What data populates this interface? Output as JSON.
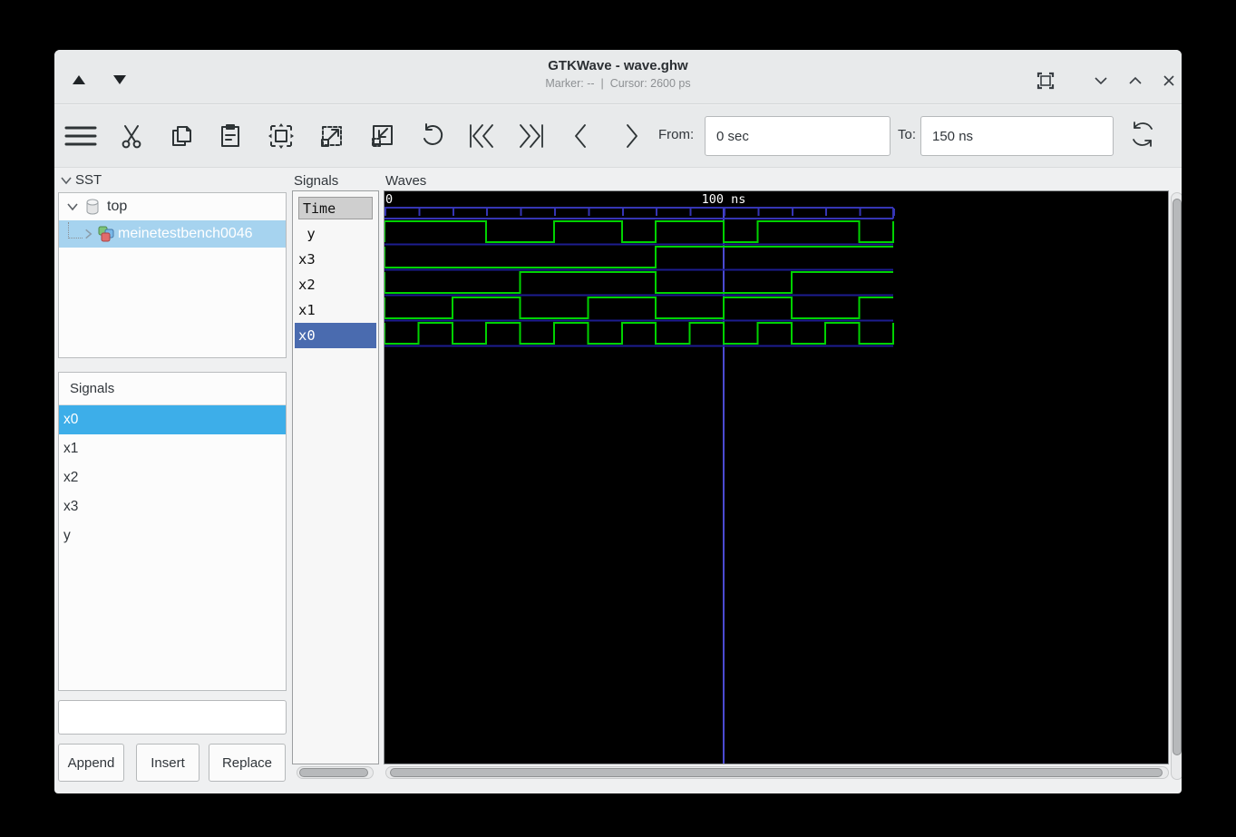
{
  "colors": {
    "selection": "#3daee9",
    "selection_inactive": "#a6d3ef",
    "signal_row_selected": "#4a6baf",
    "window_bg": "#eff0f1",
    "titlebar_bg": "#e8eaeb"
  },
  "titlebar": {
    "title": "GTKWave - wave.ghw",
    "marker_text": "Marker: --",
    "separator": "|",
    "cursor_text": "Cursor: 2600 ps"
  },
  "toolbar": {
    "from_label": "From:",
    "from_value": "0 sec",
    "to_label": "To:",
    "to_value": "150 ns"
  },
  "sst": {
    "header": "SST",
    "nodes": [
      {
        "label": "top",
        "expanded": true
      },
      {
        "label": "meinetestbench0046",
        "expanded": false,
        "selected": true
      }
    ]
  },
  "search_panel": {
    "header": "Signals",
    "items": [
      "x0",
      "x1",
      "x2",
      "x3",
      "y"
    ],
    "selected_item": "x0",
    "search_value": "",
    "buttons": [
      "Append",
      "Insert",
      "Replace"
    ]
  },
  "signals_panel": {
    "frame_label": "Signals",
    "time_header": "Time",
    "rows": [
      " y",
      "x3",
      "x2",
      "x1",
      "x0"
    ],
    "selected_row": "x0"
  },
  "waves_panel": {
    "frame_label": "Waves"
  },
  "chart_data": {
    "type": "digital-waveform",
    "time_unit": "ns",
    "t_start": 0,
    "t_end": 150,
    "tick_interval": 10,
    "timeline_labels": [
      {
        "t": 0,
        "text": "0"
      },
      {
        "t": 100,
        "text": "100 ns"
      }
    ],
    "grid_vertical_lines_t": [
      100
    ],
    "signals": [
      {
        "name": "y",
        "initial": 1,
        "toggle_times": [
          30,
          50,
          70,
          80,
          100,
          110,
          140,
          150
        ]
      },
      {
        "name": "x3",
        "initial": 0,
        "toggle_times": [
          80
        ]
      },
      {
        "name": "x2",
        "initial": 0,
        "toggle_times": [
          40,
          80,
          120
        ]
      },
      {
        "name": "x1",
        "initial": 0,
        "toggle_times": [
          20,
          40,
          60,
          80,
          100,
          120,
          140
        ]
      },
      {
        "name": "x0",
        "initial": 0,
        "toggle_times": [
          10,
          20,
          30,
          40,
          50,
          60,
          70,
          80,
          90,
          100,
          110,
          120,
          130,
          140,
          150
        ]
      }
    ],
    "colors": {
      "trace": "#00d200",
      "separator": "#1d1d8f",
      "ruler": "#3535b4",
      "grid_line": "#4a4ad2",
      "background": "#000000",
      "text": "#ffffff"
    }
  }
}
